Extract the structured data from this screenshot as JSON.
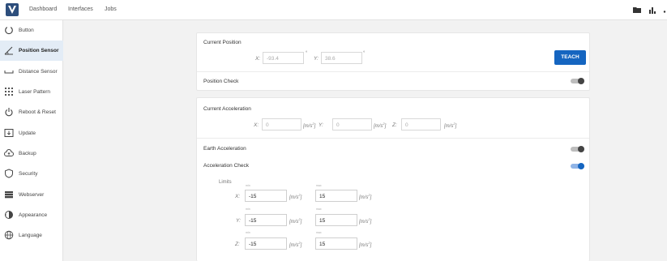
{
  "topbar": {
    "nav": [
      "Dashboard",
      "Interfaces",
      "Jobs"
    ],
    "icons": [
      "folder-icon",
      "bar-chart-icon"
    ]
  },
  "sidebar": {
    "items": [
      {
        "label": "Button",
        "icon": "power-circle-icon",
        "active": false
      },
      {
        "label": "Position Sensor",
        "icon": "angle-icon",
        "active": true
      },
      {
        "label": "Distance Sensor",
        "icon": "distance-icon",
        "active": false
      },
      {
        "label": "Laser Pattern",
        "icon": "grid-icon",
        "active": false
      },
      {
        "label": "Reboot & Reset",
        "icon": "power-icon",
        "active": false
      },
      {
        "label": "Update",
        "icon": "update-icon",
        "active": false
      },
      {
        "label": "Backup",
        "icon": "cloud-upload-icon",
        "active": false
      },
      {
        "label": "Security",
        "icon": "shield-icon",
        "active": false
      },
      {
        "label": "Webserver",
        "icon": "server-icon",
        "active": false
      },
      {
        "label": "Appearance",
        "icon": "appearance-icon",
        "active": false
      },
      {
        "label": "Language",
        "icon": "globe-icon",
        "active": false
      }
    ]
  },
  "position": {
    "title": "Current Position",
    "x_label": "X:",
    "x_value": "-93.4",
    "y_label": "Y:",
    "y_value": "38.6",
    "unit": "°",
    "teach": "TEACH",
    "check_label": "Position Check",
    "check_on": false
  },
  "acceleration": {
    "title": "Current Acceleration",
    "x_label": "X:",
    "y_label": "Y:",
    "z_label": "Z:",
    "x_placeholder": "0",
    "y_placeholder": "0",
    "z_placeholder": "0",
    "unit": "[m/s",
    "unit_sup": "2",
    "unit_close": "]",
    "earth_label": "Earth Acceleration",
    "earth_on": false,
    "check_label": "Acceleration Check",
    "check_on": true,
    "limits_label": "Limits",
    "min_label": "min",
    "max_label": "max",
    "limits": [
      {
        "axis": "X:",
        "min": "-15",
        "max": "15"
      },
      {
        "axis": "Y:",
        "min": "-15",
        "max": "15"
      },
      {
        "axis": "Z:",
        "min": "-15",
        "max": "15"
      }
    ]
  },
  "colors": {
    "accent": "#1565c0",
    "active_item_bg": "#e3ecf6",
    "page_bg": "#f2f2f2"
  }
}
